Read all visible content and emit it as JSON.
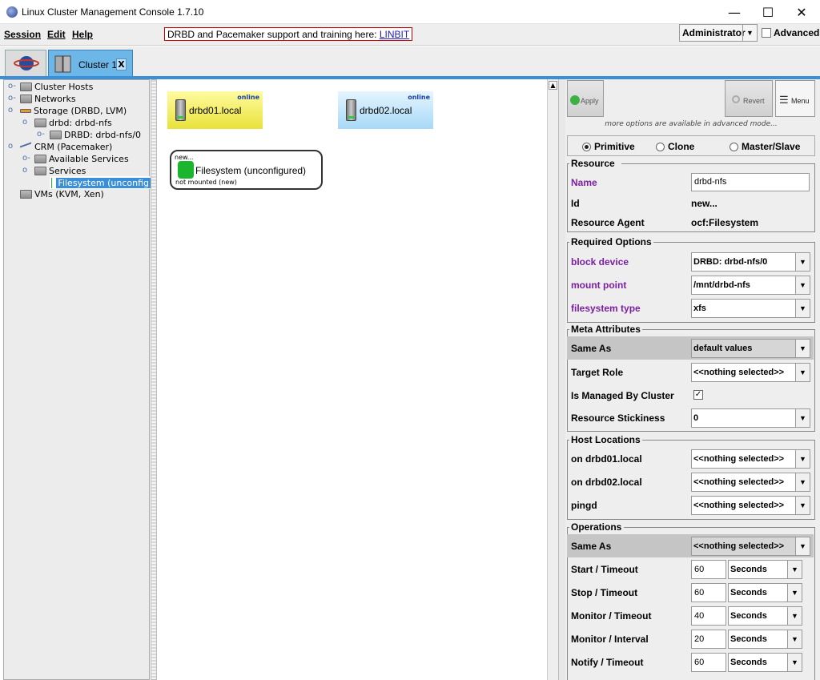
{
  "window": {
    "title": "Linux Cluster Management Console 1.7.10",
    "min": "—",
    "max": "☐",
    "close": "✕"
  },
  "menu": {
    "session": "Session",
    "edit": "Edit",
    "help": "Help"
  },
  "banner": {
    "text": "DRBD and Pacemaker support and training here: ",
    "link": "LINBIT"
  },
  "user": {
    "role": "Administrator",
    "advanced": "Advanced"
  },
  "tabs": {
    "cluster": "Cluster 1",
    "close": "X"
  },
  "tree": {
    "cluster_hosts": "Cluster Hosts",
    "networks": "Networks",
    "storage": "Storage (DRBD, LVM)",
    "drbd": "drbd: drbd-nfs",
    "drbd_vol": "DRBD: drbd-nfs/0",
    "crm": "CRM (Pacemaker)",
    "available_services": "Available Services",
    "services": "Services",
    "filesystem": "Filesystem (unconfig",
    "vms": "VMs (KVM, Xen)"
  },
  "graph": {
    "hosts": [
      {
        "name": "drbd01.local",
        "status": "online"
      },
      {
        "name": "drbd02.local",
        "status": "online"
      }
    ],
    "service": {
      "top": "new...",
      "title": "Filesystem (unconfigured)",
      "bottom": "not mounted (new)"
    }
  },
  "panel": {
    "apply": "Apply",
    "revert": "Revert",
    "menu": "Menu",
    "hint": "more options are available in advanced mode...",
    "types": {
      "primitive": "Primitive",
      "clone": "Clone",
      "master_slave": "Master/Slave"
    },
    "resource": {
      "title": "Resource",
      "name_label": "Name",
      "name_value": "drbd-nfs",
      "id_label": "Id",
      "id_value": "new...",
      "agent_label": "Resource Agent",
      "agent_value": "ocf:Filesystem"
    },
    "required": {
      "title": "Required Options",
      "block_label": "block device",
      "block_value": "DRBD: drbd-nfs/0",
      "mount_label": "mount point",
      "mount_value": "/mnt/drbd-nfs",
      "fs_label": "filesystem type",
      "fs_value": "xfs"
    },
    "meta": {
      "title": "Meta Attributes",
      "same_label": "Same As",
      "same_value": "default values",
      "role_label": "Target Role",
      "role_value": "<<nothing selected>>",
      "managed_label": "Is Managed By Cluster",
      "managed_check": "✓",
      "stick_label": "Resource Stickiness",
      "stick_value": "0"
    },
    "locations": {
      "title": "Host Locations",
      "h1_label": "on drbd01.local",
      "h1_value": "<<nothing selected>>",
      "h2_label": "on drbd02.local",
      "h2_value": "<<nothing selected>>",
      "pingd_label": "pingd",
      "pingd_value": "<<nothing selected>>"
    },
    "operations": {
      "title": "Operations",
      "same_label": "Same As",
      "same_value": "<<nothing selected>>",
      "rows": [
        {
          "label": "Start / Timeout",
          "value": "60",
          "unit": "Seconds"
        },
        {
          "label": "Stop / Timeout",
          "value": "60",
          "unit": "Seconds"
        },
        {
          "label": "Monitor / Timeout",
          "value": "40",
          "unit": "Seconds"
        },
        {
          "label": "Monitor / Interval",
          "value": "20",
          "unit": "Seconds"
        },
        {
          "label": "Notify / Timeout",
          "value": "60",
          "unit": "Seconds"
        }
      ]
    }
  }
}
